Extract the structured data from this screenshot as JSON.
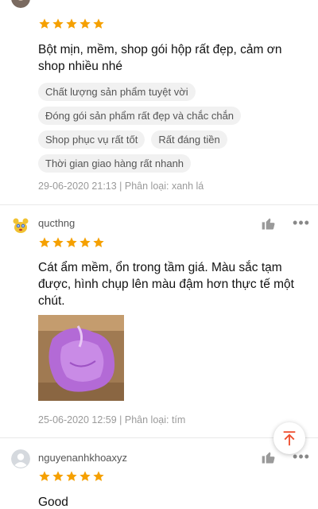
{
  "reviews": [
    {
      "username": "",
      "rating": 5,
      "text": "Bột mịn, mềm, shop gói hộp rất đẹp, cảm ơn shop nhiều nhé",
      "tags": [
        "Chất lượng sản phẩm tuyệt vời",
        "Đóng gói sản phẩm rất đẹp và chắc chắn",
        "Shop phục vụ rất tốt",
        "Rất đáng tiền",
        "Thời gian giao hàng rất nhanh"
      ],
      "meta": "29-06-2020 21:13 | Phân loại: xanh lá"
    },
    {
      "username": "qucthng",
      "rating": 5,
      "text": "Cát ẩm mềm, ổn trong tầm giá. Màu sắc tạm được, hình chụp lên màu đậm hơn thực tế một chút.",
      "photo": "product-photo-purple-sand",
      "meta": "25-06-2020 12:59 | Phân loại: tím"
    },
    {
      "username": "nguyenanhkhoaxyz",
      "rating": 5,
      "text": "Good"
    }
  ],
  "icons": {
    "star": "star-icon",
    "like": "thumbs-up-icon",
    "more": "more-options-icon",
    "scroll_top": "arrow-up-icon"
  },
  "colors": {
    "star": "#f5a000",
    "scroll_top": "#ee4d2d"
  }
}
